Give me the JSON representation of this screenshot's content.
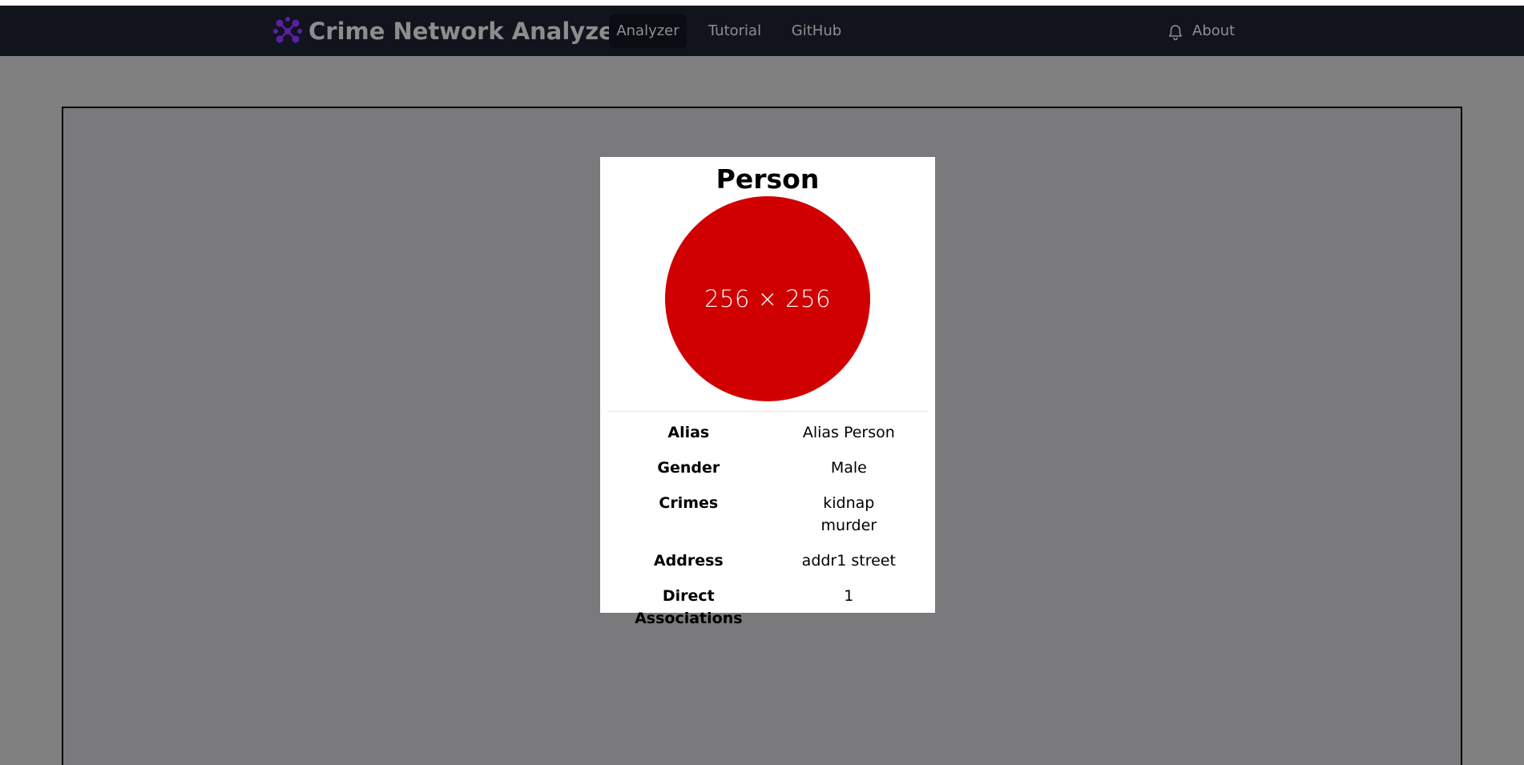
{
  "navbar": {
    "brand_title": "Crime Network Analyzer",
    "items": [
      {
        "label": "Analyzer",
        "active": true
      },
      {
        "label": "Tutorial",
        "active": false
      },
      {
        "label": "GitHub",
        "active": false
      }
    ],
    "about_label": "About",
    "icons": {
      "brand": "network-logo-icon",
      "bell": "bell-icon"
    }
  },
  "card": {
    "title": "Person",
    "avatar_label": "256 × 256",
    "avatar_color": "#d00000",
    "rows": [
      {
        "key": "Alias",
        "value": "Alias Person"
      },
      {
        "key": "Gender",
        "value": "Male"
      },
      {
        "key": "Crimes",
        "values": [
          "kidnap",
          "murder"
        ]
      },
      {
        "key": "Address",
        "value": "addr1 street"
      },
      {
        "key": "Direct Associations",
        "value": "1"
      }
    ]
  },
  "colors": {
    "navbar_bg": "#11131d",
    "page_bg": "#808080",
    "brand_accent": "#5b1fa8"
  }
}
